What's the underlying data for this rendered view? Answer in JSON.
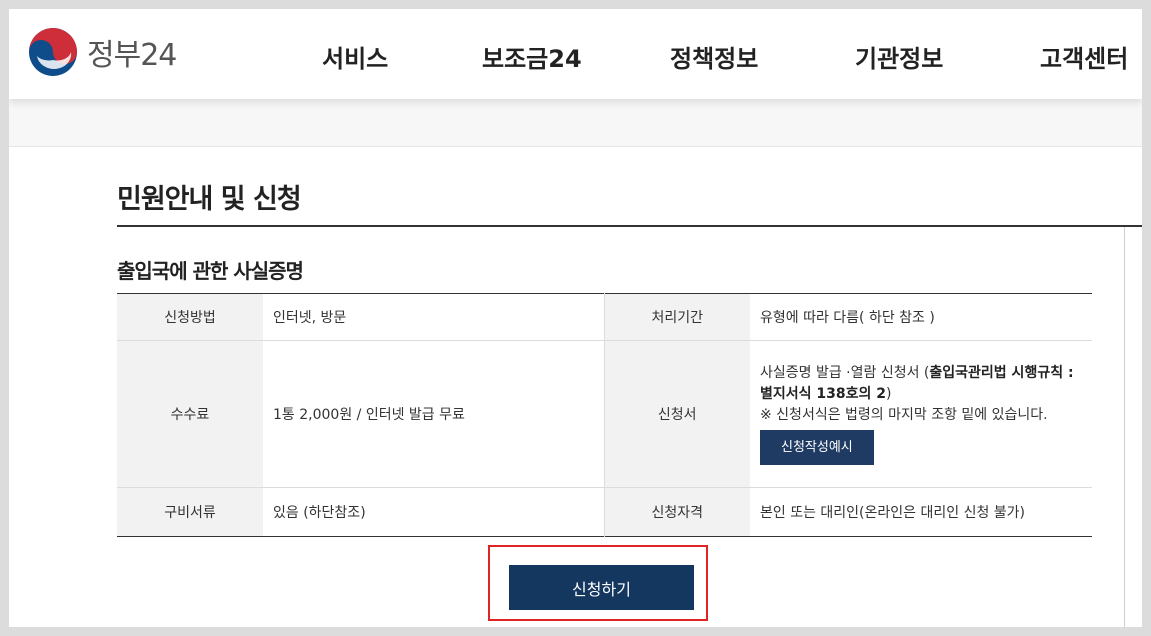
{
  "header": {
    "logo_text": "정부24",
    "nav": [
      "서비스",
      "보조금24",
      "정책정보",
      "기관정보",
      "고객센터"
    ]
  },
  "page": {
    "title": "민원안내 및 신청",
    "section_title": "출입국에 관한 사실증명"
  },
  "table": {
    "method_label": "신청방법",
    "method_value": "인터넷, 방문",
    "period_label": "처리기간",
    "period_value": "유형에 따라 다름( 하단 참조 )",
    "fee_label": "수수료",
    "fee_value": "1통 2,000원 / 인터넷 발급 무료",
    "form_label": "신청서",
    "form_text": "사실증명 발급 ·열람 신청서 (",
    "form_bold": "출입국관리법 시행규칙 : 별지서식 138호의 2",
    "form_close": ")",
    "form_note": "※ 신청서식은 법령의 마지막 조항 밑에 있습니다.",
    "form_example_button": "신청작성예시",
    "docs_label": "구비서류",
    "docs_value": "있음 (하단참조)",
    "qualification_label": "신청자격",
    "qualification_value": "본인 또는 대리인(온라인은 대리인 신청 불가)"
  },
  "apply_button": "신청하기",
  "colors": {
    "primary_navy": "#143760",
    "highlight_red": "#e02424",
    "logo_red": "#cd2e3a",
    "logo_blue": "#0f4c8a"
  }
}
